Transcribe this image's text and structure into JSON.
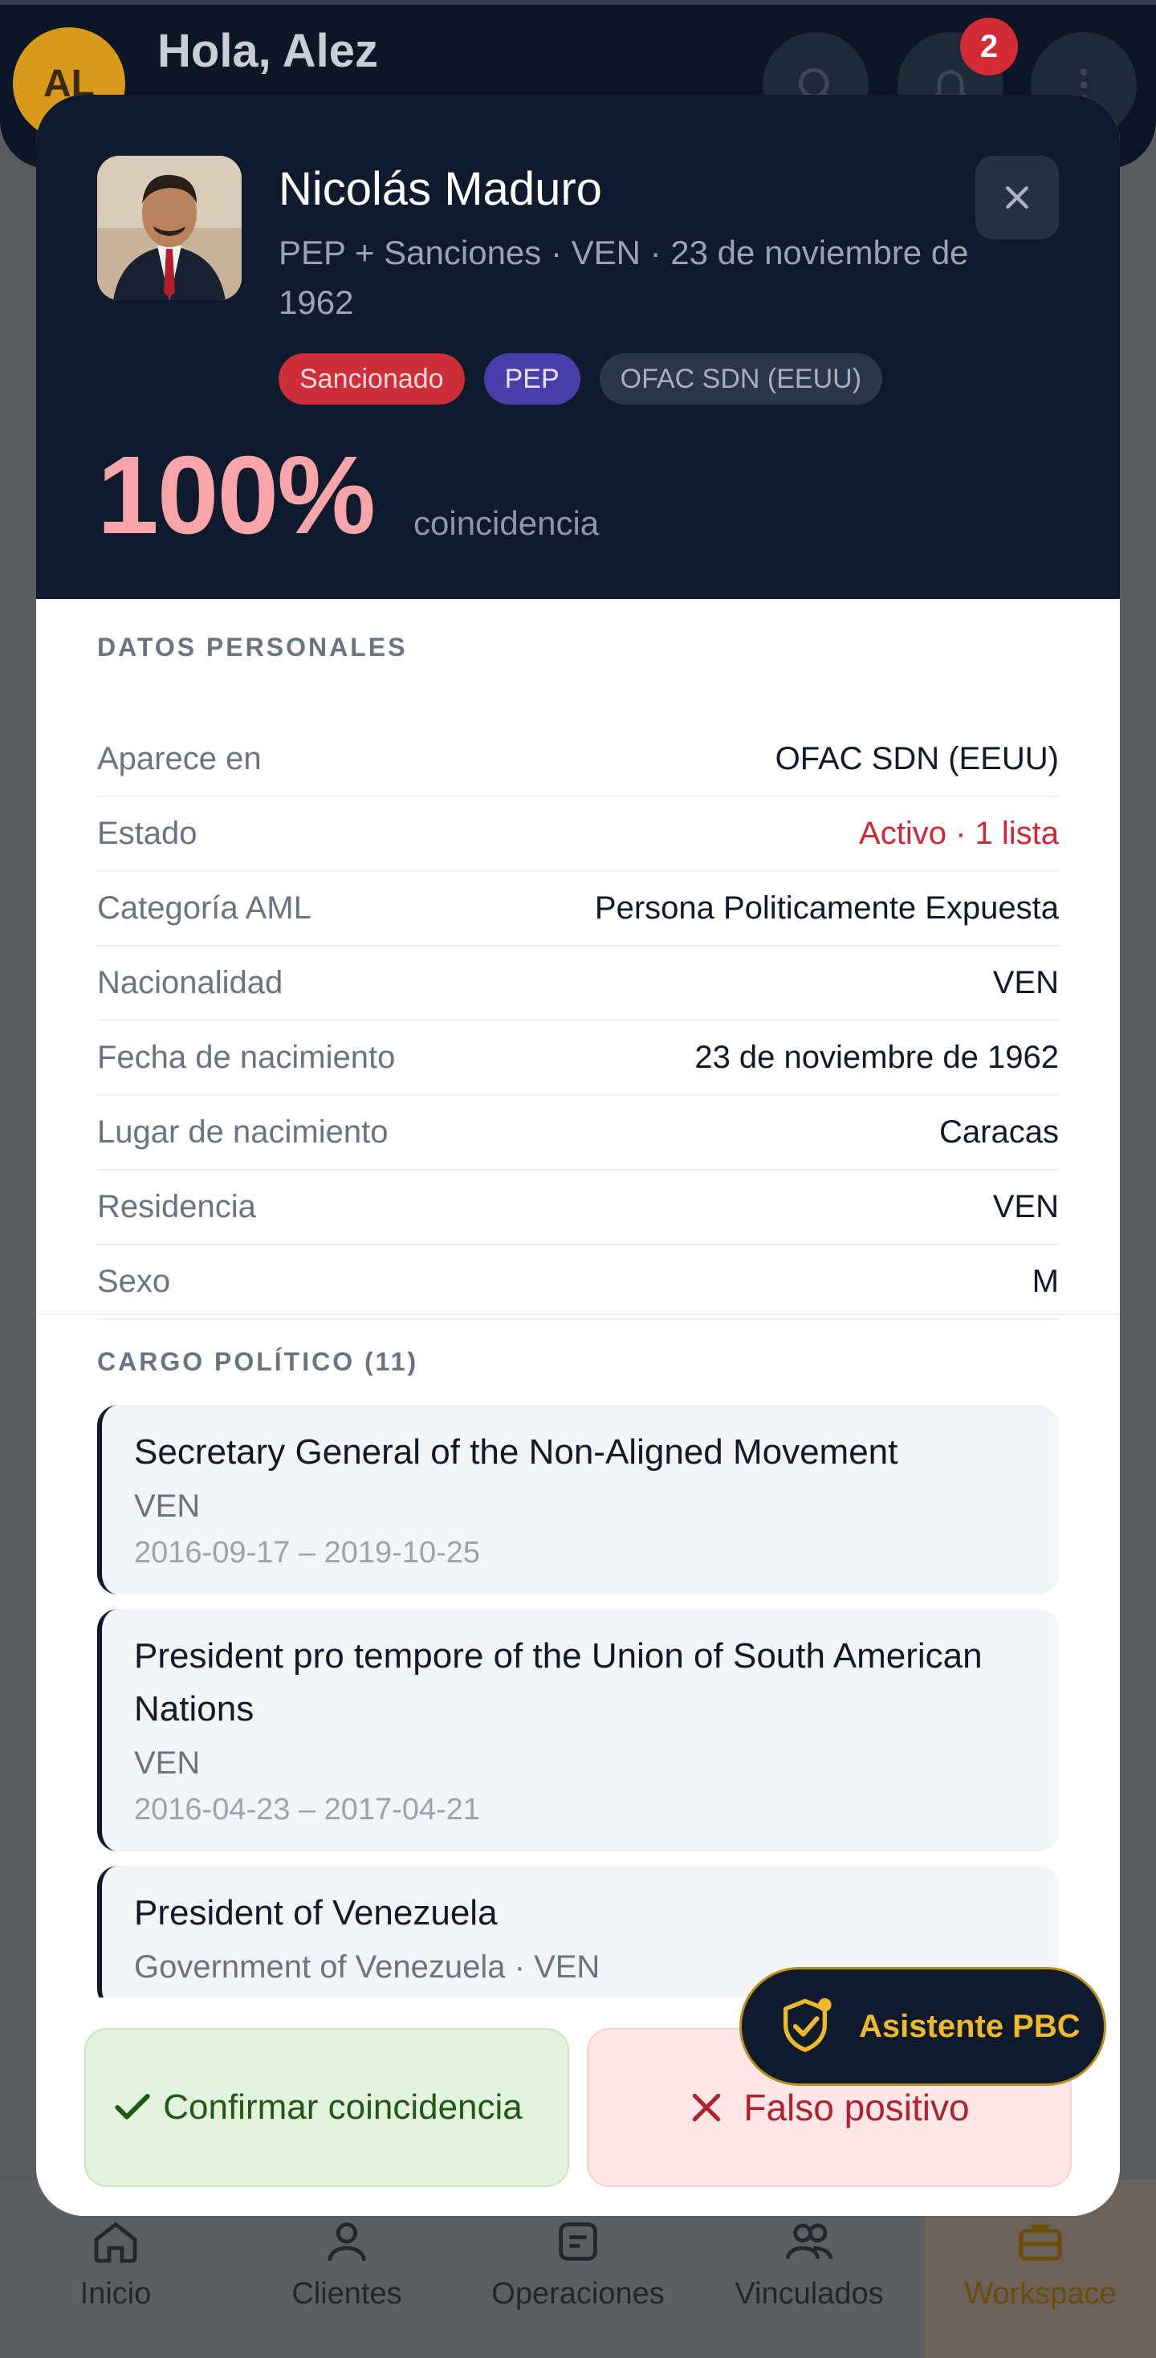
{
  "app": {
    "avatar_initials": "AL",
    "greeting": "Hola, Alez",
    "notifications_count": "2"
  },
  "modal": {
    "name": "Nicolás Maduro",
    "subtitle": "PEP + Sanciones · VEN · 23 de noviembre de 1962",
    "badges": [
      "Sancionado",
      "PEP",
      "OFAC SDN (EEUU)"
    ],
    "score": "100%",
    "score_label": "coincidencia"
  },
  "personal": {
    "title": "DATOS PERSONALES",
    "rows": [
      {
        "k": "Aparece en",
        "v": "OFAC SDN (EEUU)"
      },
      {
        "k": "Estado",
        "v": "Activo · 1 lista"
      },
      {
        "k": "Categoría AML",
        "v": "Persona Politicamente Expuesta"
      },
      {
        "k": "Nacionalidad",
        "v": "VEN"
      },
      {
        "k": "Fecha de nacimiento",
        "v": "23 de noviembre de 1962"
      },
      {
        "k": "Lugar de nacimiento",
        "v": "Caracas"
      },
      {
        "k": "Residencia",
        "v": "VEN"
      },
      {
        "k": "Sexo",
        "v": "M"
      }
    ]
  },
  "positions": {
    "title": "CARGO POLÍTICO (11)",
    "items": [
      {
        "title": "Secretary General of the Non-Aligned Movement",
        "sub": "VEN",
        "dates": "2016-09-17 – 2019-10-25"
      },
      {
        "title": "President pro tempore of the Union of South American Nations",
        "sub": "VEN",
        "dates": "2016-04-23 – 2017-04-21"
      },
      {
        "title": "President of Venezuela",
        "sub": "Government of Venezuela · VEN",
        "dates": ""
      }
    ]
  },
  "actions": {
    "confirm": "Confirmar coincidencia",
    "false_positive": "Falso positivo",
    "assistant": "Asistente PBC"
  },
  "nav": [
    {
      "label": "Inicio",
      "icon": "home-icon"
    },
    {
      "label": "Clientes",
      "icon": "user-icon"
    },
    {
      "label": "Operaciones",
      "icon": "document-icon"
    },
    {
      "label": "Vinculados",
      "icon": "users-icon"
    },
    {
      "label": "Workspace",
      "icon": "briefcase-icon"
    }
  ],
  "colors": {
    "header_bg": "#0f1b2d",
    "danger": "#cf2734",
    "accent": "#f0b92c",
    "success": "#1f5a14"
  }
}
